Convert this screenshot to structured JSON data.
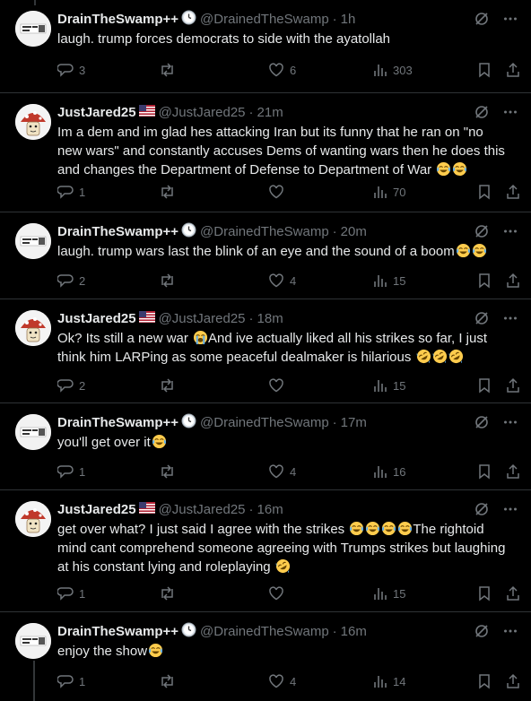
{
  "posts": [
    {
      "author": "DrainTheSwamp++",
      "badge": "clock-emoji",
      "handle": "@DrainedTheSwamp",
      "time": "1h",
      "lines": [
        "laugh. trump forces democrats to side with the ayatollah"
      ],
      "replies": "3",
      "retweets": "",
      "likes": "6",
      "views": "303"
    },
    {
      "author": "JustJared25",
      "badge": "us-flag",
      "handle": "@JustJared25",
      "time": "21m",
      "lines": [
        "Im a dem and im glad hes attacking Iran but its funny that he ran on \"no",
        "new wars\" and constantly accuses Dems of wanting wars then he does this",
        "and changes the Department of Defense to Department of War "
      ],
      "replies": "1",
      "retweets": "",
      "likes": "",
      "views": "70"
    },
    {
      "author": "DrainTheSwamp++",
      "badge": "clock-emoji",
      "handle": "@DrainedTheSwamp",
      "time": "20m",
      "lines": [
        "laugh. trump wars last the blink of an eye and the sound of a boom"
      ],
      "replies": "2",
      "retweets": "",
      "likes": "4",
      "views": "15"
    },
    {
      "author": "JustJared25",
      "badge": "us-flag",
      "handle": "@JustJared25",
      "time": "18m",
      "lines": [
        "Ok? Its still a new war ",
        "And ive actually liked all his strikes so far, I just",
        "think him LARPing as some peaceful dealmaker is hilarious "
      ],
      "replies": "2",
      "retweets": "",
      "likes": "",
      "views": "15"
    },
    {
      "author": "DrainTheSwamp++",
      "badge": "clock-emoji",
      "handle": "@DrainedTheSwamp",
      "time": "17m",
      "lines": [
        "you'll get over it"
      ],
      "replies": "1",
      "retweets": "",
      "likes": "4",
      "views": "16"
    },
    {
      "author": "JustJared25",
      "badge": "us-flag",
      "handle": "@JustJared25",
      "time": "16m",
      "lines": [
        "get over what? I just said I agree with the strikes ",
        "The rightoid",
        "mind cant comprehend someone agreeing with Trumps strikes but laughing",
        "at his constant lying and roleplaying "
      ],
      "replies": "1",
      "retweets": "",
      "likes": "",
      "views": "15"
    },
    {
      "author": "DrainTheSwamp++",
      "badge": "clock-emoji",
      "handle": "@DrainedTheSwamp",
      "time": "16m",
      "lines": [
        "enjoy the show"
      ],
      "replies": "1",
      "retweets": "",
      "likes": "4",
      "views": "14"
    }
  ]
}
